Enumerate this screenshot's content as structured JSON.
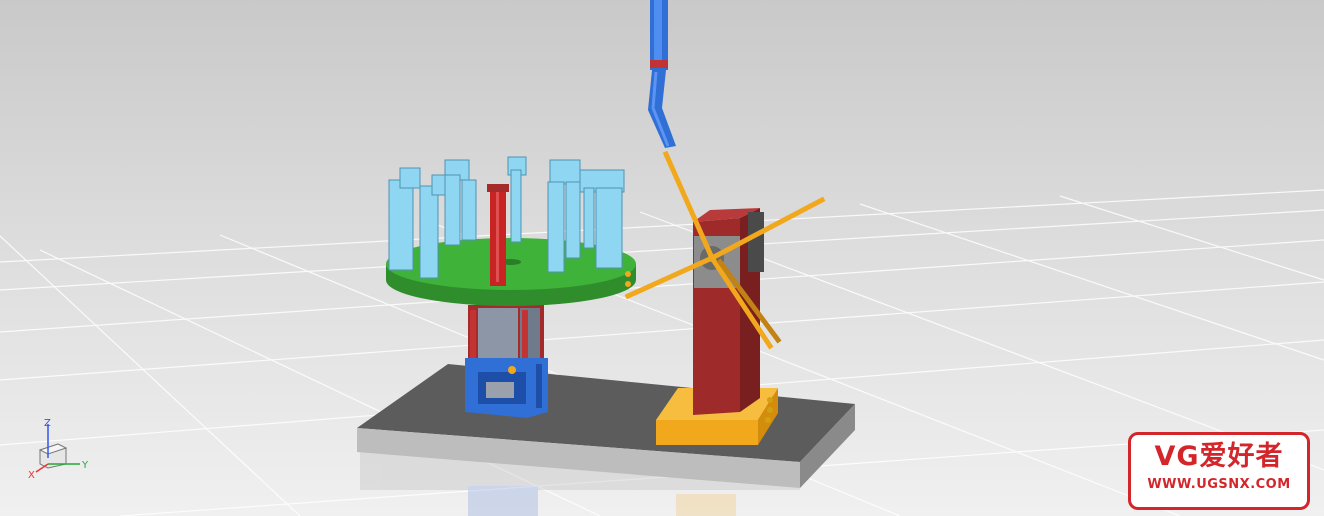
{
  "viewport": {
    "background_top": "#c9c9c9",
    "background_bottom": "#f0f0f0"
  },
  "colors": {
    "base_plate": "#5c5c5c",
    "turntable": "#3fb23a",
    "fixture": "#8fd6f2",
    "red_parts": "#a52a2a",
    "blue_parts": "#2f6fd6",
    "orange_parts": "#f2a81d"
  },
  "triad": {
    "z_label": "Z",
    "y_label": "Y",
    "x_label": "X",
    "z_color": "#3355ee",
    "y_color": "#22aa33",
    "x_color": "#ee3333"
  },
  "watermark": {
    "title": "VG爱好者",
    "url": "WWW.UGSNX.COM",
    "color": "#d3262b"
  }
}
